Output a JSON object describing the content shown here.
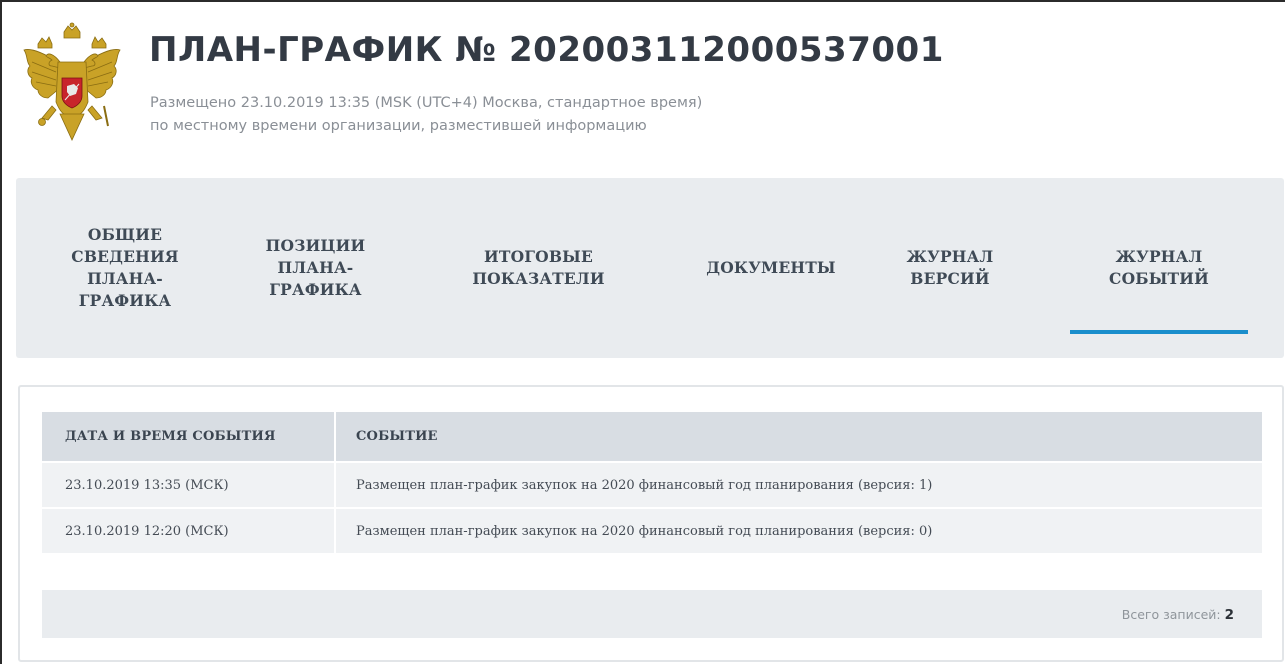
{
  "header": {
    "title": "ПЛАН-ГРАФИК № 202003112000537001",
    "published_line": "Размещено 23.10.2019 13:35 (MSK (UTC+4) Москва, стандартное время)",
    "timezone_note": "по местному времени организации, разместившей информацию",
    "emblem_icon": "russian-coat-of-arms-icon"
  },
  "tabs": [
    {
      "label": "ОБЩИЕ\nСВЕДЕНИЯ\nПЛАНА-\nГРАФИКА",
      "active": false
    },
    {
      "label": "ПОЗИЦИИ\nПЛАНА-\nГРАФИКА",
      "active": false
    },
    {
      "label": "ИТОГОВЫЕ\nПОКАЗАТЕЛИ",
      "active": false
    },
    {
      "label": "ДОКУМЕНТЫ",
      "active": false
    },
    {
      "label": "ЖУРНАЛ\nВЕРСИЙ",
      "active": false
    },
    {
      "label": "ЖУРНАЛ\nСОБЫТИЙ",
      "active": true
    }
  ],
  "events_table": {
    "columns": [
      "ДАТА И ВРЕМЯ СОБЫТИЯ",
      "СОБЫТИЕ"
    ],
    "rows": [
      {
        "datetime": "23.10.2019 13:35 (МСК)",
        "event": "Размещен план-график закупок на 2020 финансовый год планирования (версия: 1)"
      },
      {
        "datetime": "23.10.2019 12:20 (МСК)",
        "event": "Размещен план-график закупок на 2020 финансовый год планирования (версия: 0)"
      }
    ]
  },
  "footer": {
    "total_label": "Всего записей:",
    "total_count": "2"
  },
  "colors": {
    "accent": "#1a8ecc",
    "tab_bg": "#e9ecef",
    "table_header_bg": "#d8dde3",
    "row_bg": "#f0f2f4"
  }
}
